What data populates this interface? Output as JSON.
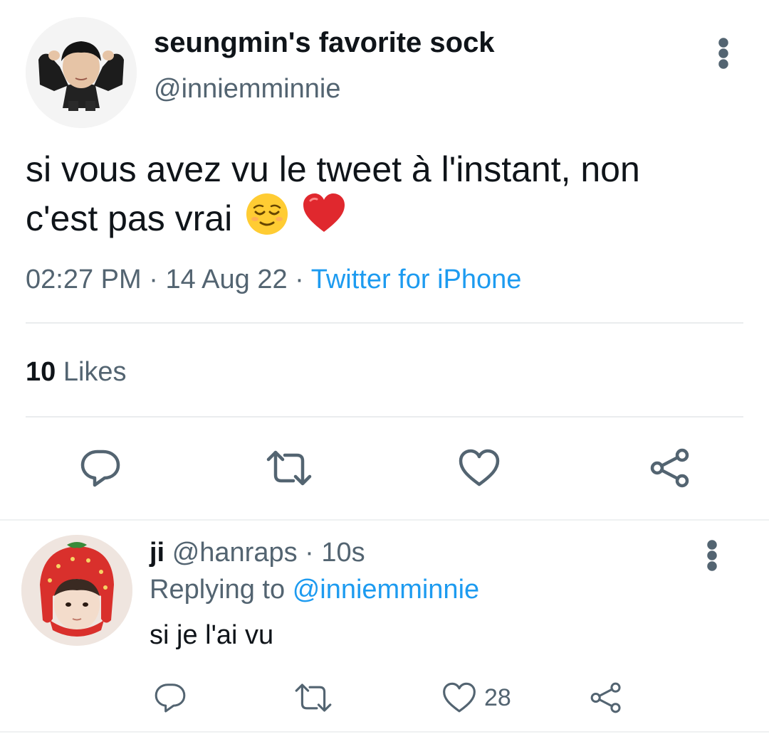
{
  "tweet": {
    "display_name": "seungmin's favorite sock",
    "handle": "@inniemminnie",
    "text_line1": "si vous avez vu le tweet à l'instant, non",
    "text_line2": "c'est pas vrai",
    "emojis": [
      "relieved-face-emoji",
      "red-heart-emoji"
    ],
    "time": "02:27 PM",
    "sep1": "·",
    "date": "14 Aug 22",
    "sep2": "·",
    "source": "Twitter for iPhone",
    "likes_count": "10",
    "likes_label": "Likes",
    "actions": [
      "reply-icon",
      "retweet-icon",
      "like-icon",
      "share-icon"
    ]
  },
  "reply": {
    "name": "ji",
    "handle": "@hanraps",
    "sep": "·",
    "time": "10s",
    "replying_prefix": "Replying to",
    "replying_to": "@inniemminnie",
    "text": "si je l'ai vu",
    "like_count": "28",
    "actions": [
      "reply-icon",
      "retweet-icon",
      "like-icon",
      "share-icon"
    ]
  },
  "colors": {
    "text": "#0f1419",
    "secondary": "#536471",
    "link": "#1d9bf0",
    "divider": "#eaecee"
  }
}
